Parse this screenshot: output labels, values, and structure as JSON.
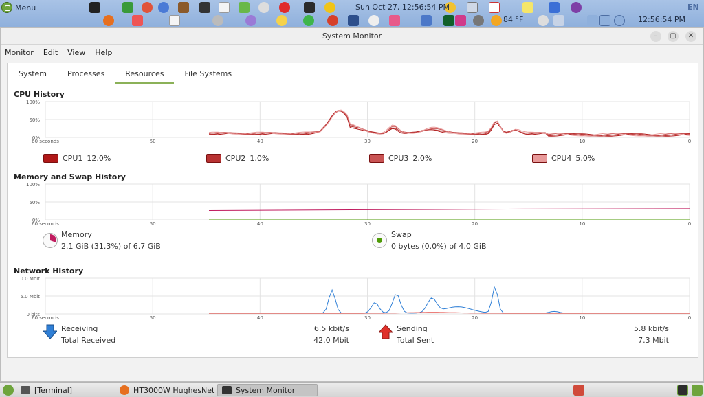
{
  "top_panel": {
    "menu_label": "Menu",
    "clock_top": "Sun Oct 27, 12:56:54 PM",
    "weather": "84 °F",
    "lang": "EN",
    "clock_right": "12:56:54 PM"
  },
  "window": {
    "title": "System Monitor",
    "minimize": "–",
    "maximize": "▢",
    "close": "✕"
  },
  "menubar": [
    "Monitor",
    "Edit",
    "View",
    "Help"
  ],
  "tabs": [
    "System",
    "Processes",
    "Resources",
    "File Systems"
  ],
  "active_tab": "Resources",
  "cpu": {
    "title": "CPU History",
    "y_ticks": [
      "100%",
      "50%",
      "0%"
    ],
    "x_ticks": [
      "60 seconds",
      "50",
      "40",
      "30",
      "20",
      "10",
      "0"
    ],
    "legend": [
      {
        "name": "CPU1",
        "value": "12.0%",
        "color": "#b01818"
      },
      {
        "name": "CPU2",
        "value": "1.0%",
        "color": "#b83232"
      },
      {
        "name": "CPU3",
        "value": "2.0%",
        "color": "#c95454"
      },
      {
        "name": "CPU4",
        "value": "5.0%",
        "color": "#e89a9a"
      }
    ]
  },
  "memory": {
    "title": "Memory and Swap History",
    "y_ticks": [
      "100%",
      "50%",
      "0%"
    ],
    "x_ticks": [
      "60 seconds",
      "50",
      "40",
      "30",
      "20",
      "10",
      "0"
    ],
    "memory_label": "Memory",
    "memory_value": "2.1 GiB (31.3%) of 6.7 GiB",
    "memory_color": "#c01c5f",
    "swap_label": "Swap",
    "swap_value": "0 bytes (0.0%) of 4.0 GiB",
    "swap_color": "#4e9a06"
  },
  "network": {
    "title": "Network History",
    "y_ticks": [
      "10.0 Mbit",
      "5.0 Mbit",
      "0 bits"
    ],
    "x_ticks": [
      "60 seconds",
      "50",
      "40",
      "30",
      "20",
      "10",
      "0"
    ],
    "receiving_label": "Receiving",
    "receiving_value": "6.5 kbit/s",
    "total_received_label": "Total Received",
    "total_received_value": "42.0 Mbit",
    "sending_label": "Sending",
    "sending_value": "5.8 kbit/s",
    "total_sent_label": "Total Sent",
    "total_sent_value": "7.3 Mbit",
    "receive_color": "#2f7fd6",
    "send_color": "#e0302a"
  },
  "taskbar": [
    {
      "label": "[Terminal]"
    },
    {
      "label": "HT3000W HughesNet ..."
    },
    {
      "label": "System Monitor"
    }
  ]
}
